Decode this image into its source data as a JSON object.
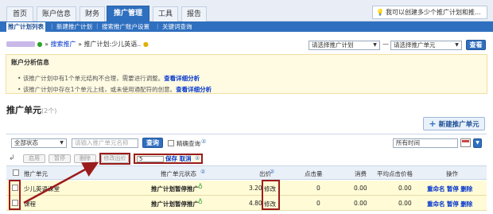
{
  "nav": {
    "tabs": [
      "首页",
      "账户信息",
      "财务",
      "推广管理",
      "工具",
      "报告"
    ],
    "active_tab": "推广管理",
    "tip": "我可以创建多少个推广计划和推..."
  },
  "subnav": {
    "items": [
      "推广计划列表",
      "新建推广计划",
      "搜索推广账户设置",
      "关键词查询"
    ]
  },
  "breadcrumb": {
    "link": "搜索推广",
    "current": "推广计划:少儿英语..",
    "plan_select": "请选择推广计划",
    "dash": "—",
    "unit_select": "请选择推广单元",
    "search_btn": "查看"
  },
  "analysis": {
    "title": "账户分析信息",
    "lines": [
      {
        "text": "该推广计划中有1个单元结构不合理，需要进行调整。",
        "link": "查看详细分析"
      },
      {
        "text": "该推广计划中存在1个单元上线，或未使用通配符的创意。",
        "link": "查看详细分析"
      }
    ]
  },
  "section": {
    "title": "推广单元",
    "count": "(2个)",
    "new_btn": "新建推广单元"
  },
  "filter": {
    "status": "全部状态",
    "name_placeholder": "请输入推广单元名称",
    "query_btn": "查询",
    "exact_label": "精确查询",
    "time": "所有时间"
  },
  "actions": {
    "enable": "启用",
    "pause": "暂停",
    "delete": "删除",
    "edit_price": "修改出价",
    "price_value": "5",
    "save": "保存",
    "cancel": "取消"
  },
  "table": {
    "headers": [
      "推广单元",
      "推广单元状态",
      "出价",
      "点击量",
      "消费",
      "平均点击价格",
      "操作"
    ],
    "rows": [
      {
        "name": "少儿英语课堂",
        "status": "推广计划暂停推广",
        "price": "3.20",
        "edit": "修改",
        "clicks": "0",
        "cost": "0.00",
        "avg": "0.00",
        "ops": [
          "重命名",
          "暂停",
          "删除"
        ]
      },
      {
        "name": "课程",
        "status": "推广计划暂停推广",
        "price": "4.80",
        "edit": "修改",
        "clicks": "0",
        "cost": "0.00",
        "avg": "0.00",
        "ops": [
          "重命名",
          "暂停",
          "删除"
        ]
      }
    ]
  },
  "colors": {
    "brand_blue": "#2f6fbf",
    "highlight_red": "#9b1c1c",
    "row_yellow": "#fffbd6"
  }
}
